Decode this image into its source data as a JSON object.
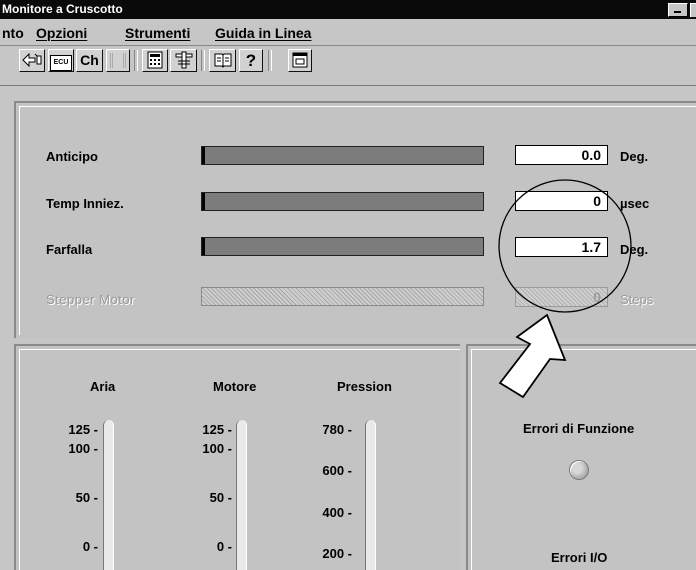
{
  "window": {
    "title": "Monitore a Cruscotto"
  },
  "menu": {
    "items": [
      "nto",
      "Opzioni",
      "Strumenti",
      "Guida in Linea"
    ]
  },
  "toolbar": {
    "buttons": [
      {
        "icon": "connect-icon",
        "label": ""
      },
      {
        "icon": "ecu-icon",
        "label": "ECU"
      },
      {
        "icon": "channel-icon",
        "label": "Ch"
      },
      {
        "icon": "disabled-icon",
        "label": ""
      },
      {
        "icon": "calculator-icon",
        "label": ""
      },
      {
        "icon": "tool-icon",
        "label": ""
      },
      {
        "icon": "book-icon",
        "label": ""
      },
      {
        "icon": "help-icon",
        "label": "?"
      },
      {
        "icon": "window-icon",
        "label": ""
      }
    ]
  },
  "monitor": {
    "rows": [
      {
        "label": "Anticipo",
        "value": "0.0",
        "unit": "Deg.",
        "enabled": true
      },
      {
        "label": "Temp Inniez.",
        "value": "0",
        "unit": "µsec",
        "enabled": true
      },
      {
        "label": "Farfalla",
        "value": "1.7",
        "unit": "Deg.",
        "enabled": true
      },
      {
        "label": "Stepper Motor",
        "value": "0",
        "unit": "Steps",
        "enabled": false
      }
    ]
  },
  "gauges": [
    {
      "title": "Aria",
      "ticks": [
        "125 -",
        "100 -",
        "50 -",
        "0 -"
      ],
      "level": 0.0
    },
    {
      "title": "Motore",
      "ticks": [
        "125 -",
        "100 -",
        "50 -",
        "0 -"
      ],
      "level": 0.0
    },
    {
      "title": "Pression",
      "ticks": [
        "780 -",
        "600 -",
        "400 -",
        "200 -"
      ],
      "level": 0.0
    }
  ],
  "errors": {
    "function_label": "Errori di Funzione",
    "io_label": "Errori I/O"
  },
  "colors": {
    "titlebar": "#0a0a0a",
    "face": "#c6c6c6",
    "bar": "#7c7c7c"
  }
}
